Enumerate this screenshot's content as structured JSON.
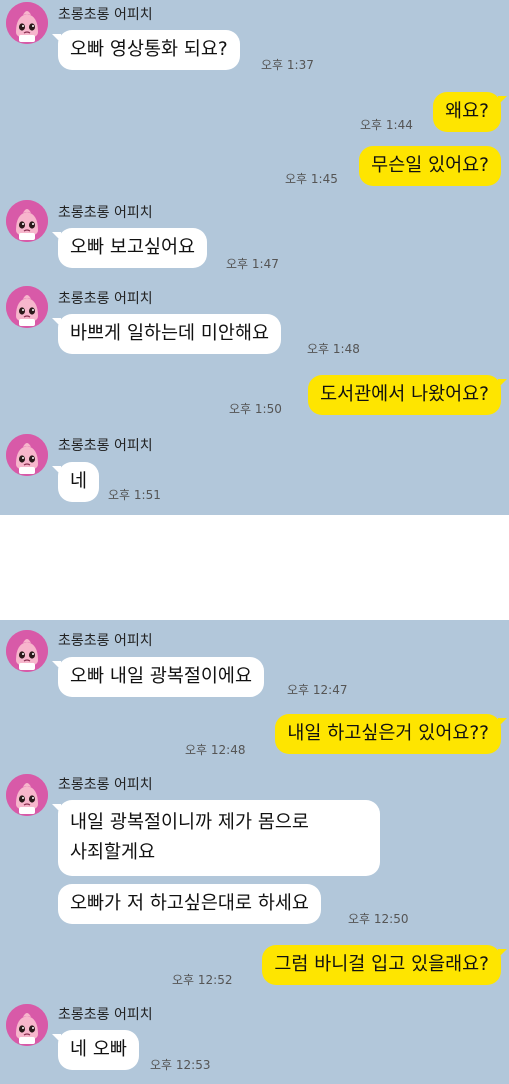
{
  "sender_name": "초롱초롱 어피치",
  "avatar_icon": "apeach-avatar-icon",
  "colors": {
    "background": "#b2c7da",
    "incoming_bubble": "#ffffff",
    "outgoing_bubble": "#fee500"
  },
  "screenshot1": [
    {
      "dir": "in",
      "text": "오빠 영상통화 되요?",
      "time": "오후 1:37"
    },
    {
      "dir": "out",
      "text": "왜요?",
      "time": "오후 1:44"
    },
    {
      "dir": "out",
      "text": "무슨일 있어요?",
      "time": "오후 1:45"
    },
    {
      "dir": "in",
      "text": "오빠 보고싶어요",
      "time": "오후 1:47"
    },
    {
      "dir": "in",
      "text": "바쁘게 일하는데 미안해요",
      "time": "오후 1:48"
    },
    {
      "dir": "out",
      "text": "도서관에서 나왔어요?",
      "time": "오후 1:50"
    },
    {
      "dir": "in",
      "text": "네",
      "time": "오후 1:51"
    }
  ],
  "screenshot2": [
    {
      "dir": "in",
      "text": "오빠 내일 광복절이에요",
      "time": "오후 12:47"
    },
    {
      "dir": "out",
      "text": "내일 하고싶은거 있어요??",
      "time": "오후 12:48"
    },
    {
      "dir": "in",
      "lines": [
        "내일 광복절이니까 제가 몸으로",
        "사죄할게요"
      ]
    },
    {
      "dir": "in",
      "text": "오빠가 저 하고싶은대로 하세요",
      "time": "오후 12:50"
    },
    {
      "dir": "out",
      "text": "그럼 바니걸 입고 있을래요?",
      "time": "오후 12:52"
    },
    {
      "dir": "in",
      "text": "네 오빠",
      "time": "오후 12:53"
    }
  ]
}
